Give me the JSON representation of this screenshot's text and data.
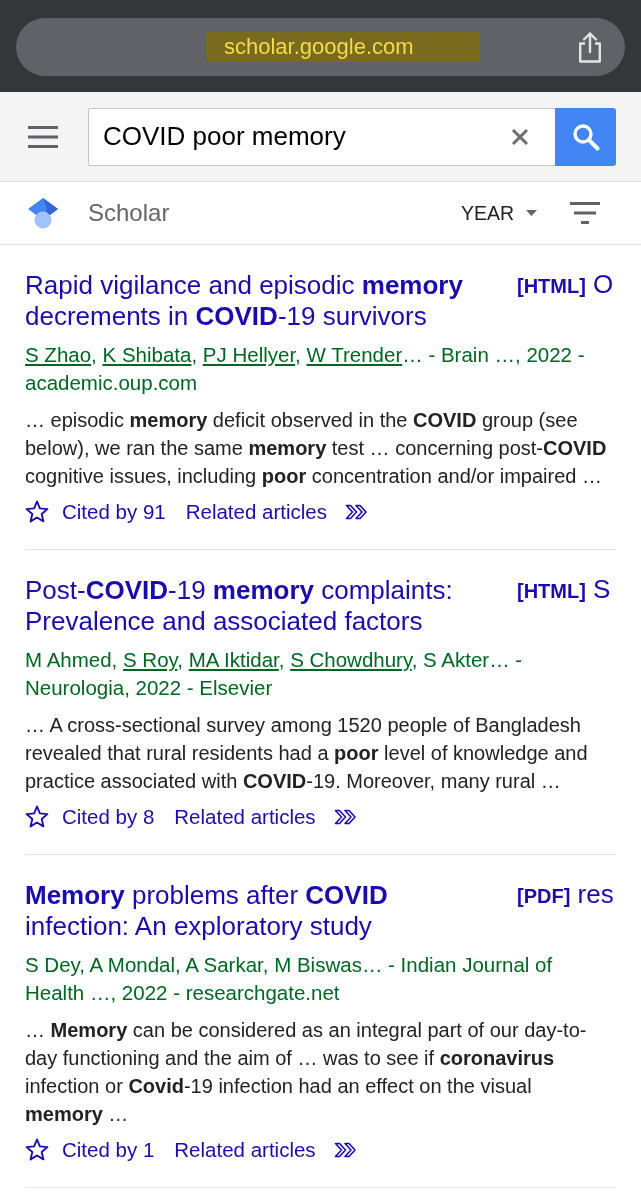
{
  "browser_bar": {
    "url": "scholar.google.com",
    "url_highlighted": true
  },
  "search": {
    "value": "COVID poor memory"
  },
  "toolbar": {
    "brand": "Scholar",
    "year_filter": "YEAR"
  },
  "results": [
    {
      "title": "Rapid vigilance and episodic **memory** decrements in **COVID**-19 survivors",
      "full_text": "**[HTML]** O",
      "byline": [
        {
          "text": "S Zhao",
          "linked": true
        },
        {
          "text": ", ",
          "linked": false
        },
        {
          "text": "K Shibata",
          "linked": true
        },
        {
          "text": ", ",
          "linked": false
        },
        {
          "text": "PJ Hellyer",
          "linked": true
        },
        {
          "text": ", ",
          "linked": false
        },
        {
          "text": "W Trender",
          "linked": true
        },
        {
          "text": "… - Brain …, 2022 - academic.oup.com",
          "linked": false
        }
      ],
      "snippet": "… episodic **memory** deficit observed in the **COVID** group (see below), we ran the same **memory** test … concerning post-**COVID** cognitive issues, including **poor** concentration and/or impaired …",
      "cited_by": "Cited by 91",
      "related": "Related articles"
    },
    {
      "title": "Post-**COVID**-19 **memory** complaints: Prevalence and associated factors",
      "full_text": "**[HTML]** S",
      "byline": [
        {
          "text": "M Ahmed, ",
          "linked": false
        },
        {
          "text": "S Roy",
          "linked": true
        },
        {
          "text": ", ",
          "linked": false
        },
        {
          "text": "MA Iktidar",
          "linked": true
        },
        {
          "text": ", ",
          "linked": false
        },
        {
          "text": "S Chowdhury",
          "linked": true
        },
        {
          "text": ", S Akter… - Neurologia, 2022 - Elsevier",
          "linked": false
        }
      ],
      "snippet": "… A cross-sectional survey among 1520 people of Bangladesh revealed that rural residents had a **poor** level of knowledge and practice associated with **COVID**-19. Moreover, many rural …",
      "cited_by": "Cited by 8",
      "related": "Related articles"
    },
    {
      "title": "**Memory** problems after **COVID** infection: An exploratory study",
      "full_text": "**[PDF]** res",
      "byline": [
        {
          "text": "S Dey, A Mondal, A Sarkar, M Biswas… - Indian Journal of Health …, 2022 - researchgate.net",
          "linked": false
        }
      ],
      "snippet": "… **Memory** can be considered as an integral part of our day-to-day functioning and the aim of … was to see if **coronavirus** infection or **Covid**-19 infection had an effect on the visual **memory** …",
      "cited_by": "Cited by 1",
      "related": "Related articles"
    }
  ]
}
